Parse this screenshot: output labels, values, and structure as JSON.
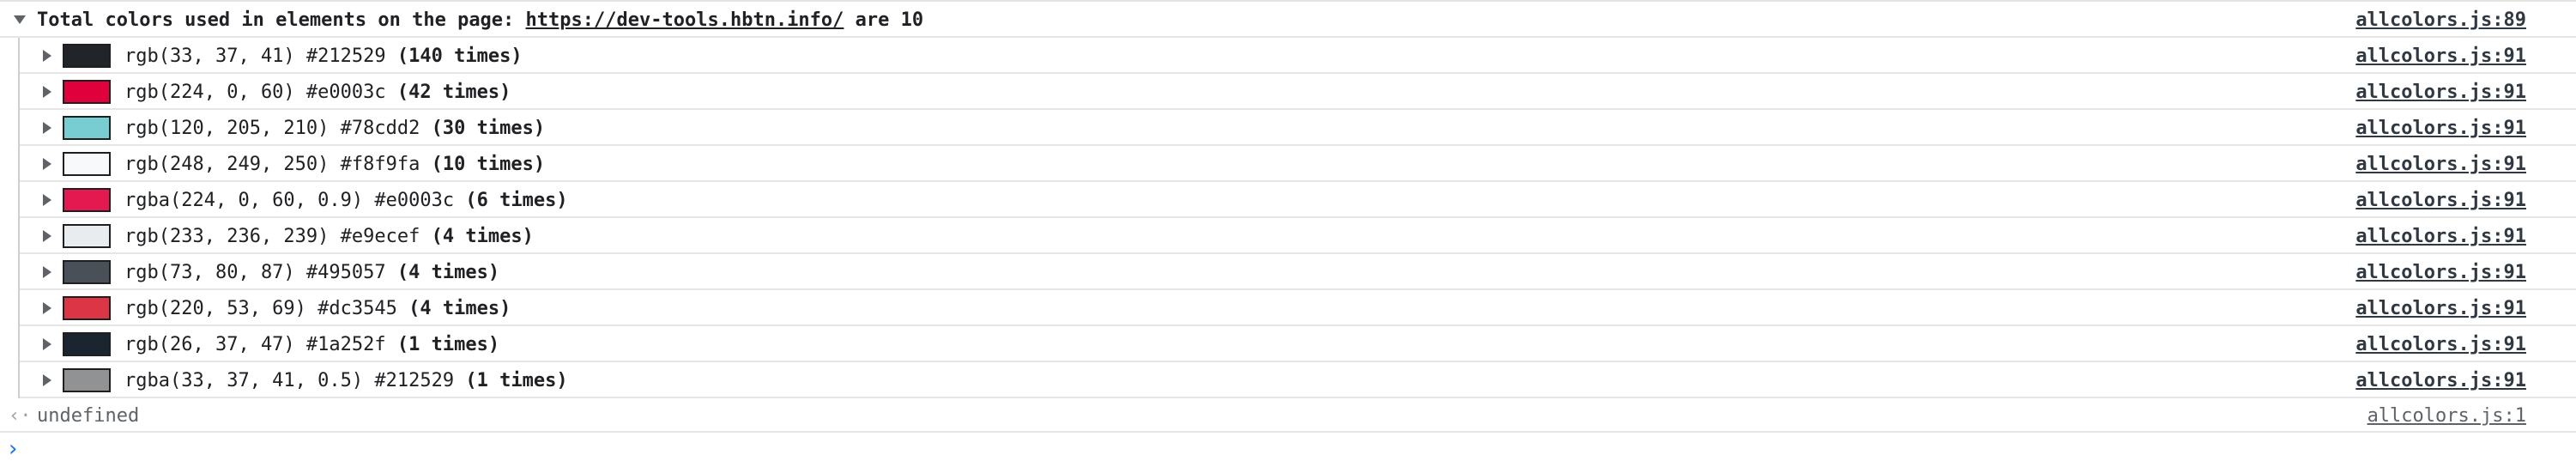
{
  "group": {
    "label_prefix": "Total colors used in elements on the page: ",
    "url": "https://dev-tools.hbtn.info/",
    "label_suffix": " are 10",
    "source": "allcolors.js:89"
  },
  "colors": [
    {
      "value": "rgb(33, 37, 41) #212529",
      "count": "(140 times)",
      "swatch": "#212529",
      "source": "allcolors.js:91"
    },
    {
      "value": "rgb(224, 0, 60) #e0003c",
      "count": "(42 times)",
      "swatch": "#e0003c",
      "source": "allcolors.js:91"
    },
    {
      "value": "rgb(120, 205, 210) #78cdd2",
      "count": "(30 times)",
      "swatch": "#78cdd2",
      "source": "allcolors.js:91"
    },
    {
      "value": "rgb(248, 249, 250) #f8f9fa",
      "count": "(10 times)",
      "swatch": "#f8f9fa",
      "source": "allcolors.js:91"
    },
    {
      "value": "rgba(224, 0, 60, 0.9) #e0003c",
      "count": "(6 times)",
      "swatch": "rgba(224, 0, 60, 0.9)",
      "source": "allcolors.js:91"
    },
    {
      "value": "rgb(233, 236, 239) #e9ecef",
      "count": "(4 times)",
      "swatch": "#e9ecef",
      "source": "allcolors.js:91"
    },
    {
      "value": "rgb(73, 80, 87) #495057",
      "count": "(4 times)",
      "swatch": "#495057",
      "source": "allcolors.js:91"
    },
    {
      "value": "rgb(220, 53, 69) #dc3545",
      "count": "(4 times)",
      "swatch": "#dc3545",
      "source": "allcolors.js:91"
    },
    {
      "value": "rgb(26, 37, 47) #1a252f",
      "count": "(1 times)",
      "swatch": "#1a252f",
      "source": "allcolors.js:91"
    },
    {
      "value": "rgba(33, 37, 41, 0.5) #212529",
      "count": "(1 times)",
      "swatch": "rgba(33, 37, 41, 0.5)",
      "source": "allcolors.js:91"
    }
  ],
  "result": {
    "arrow": "‹·",
    "text": "undefined",
    "source": "allcolors.js:1"
  },
  "prompt": {
    "icon": "›"
  }
}
